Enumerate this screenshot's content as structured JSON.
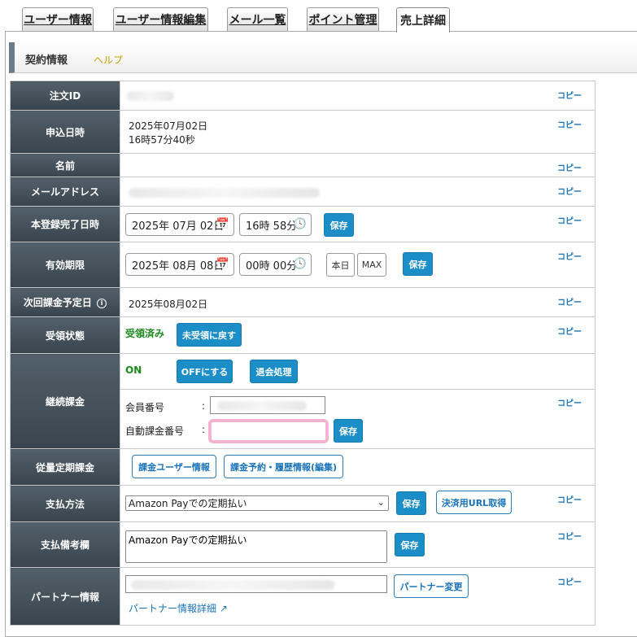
{
  "tabs": [
    {
      "label": "ユーザー情報"
    },
    {
      "label": "ユーザー情報編集"
    },
    {
      "label": "メール一覧"
    },
    {
      "label": "ポイント管理"
    },
    {
      "label": "売上詳細",
      "active": true
    }
  ],
  "section": {
    "title": "契約情報",
    "help": "ヘルプ"
  },
  "copy_label": "コピー",
  "rows": {
    "order_id": {
      "label": "注文ID"
    },
    "applied_at": {
      "label": "申込日時",
      "date": "2025年07月02日",
      "time": "16時57分40秒"
    },
    "name": {
      "label": "名前"
    },
    "email": {
      "label": "メールアドレス"
    },
    "registered_at": {
      "label": "本登録完了日時",
      "date": "2025年 07月 02日",
      "time": "16時 58分",
      "save": "保存"
    },
    "expiry": {
      "label": "有効期限",
      "date": "2025年 08月 08日",
      "time": "00時 00分",
      "today": "本日",
      "max": "MAX",
      "save": "保存"
    },
    "next_billing": {
      "label": "次回課金予定日",
      "info_icon": "info-circle-icon",
      "value": "2025年08月02日"
    },
    "receipt": {
      "label": "受領状態",
      "status": "受領済み",
      "button": "未受領に戻す"
    },
    "recurring": {
      "label": "継続課金",
      "status": "ON",
      "off_button": "OFFにする",
      "withdraw_button": "退会処理",
      "member_no_label": "会員番号",
      "auto_billing_label": "自動課金番号",
      "colon": ":",
      "save": "保存"
    },
    "metered": {
      "label": "従量定期課金",
      "user_info_button": "課金ユーザー情報",
      "reservation_button": "課金予約・履歴情報(編集)"
    },
    "payment_method": {
      "label": "支払方法",
      "selected": "Amazon Payでの定期払い",
      "save": "保存",
      "url_button": "決済用URL取得"
    },
    "payment_note": {
      "label": "支払備考欄",
      "value": "Amazon Payでの定期払い",
      "save": "保存"
    },
    "partner": {
      "label": "パートナー情報",
      "change_button": "パートナー変更",
      "detail_link": "パートナー情報詳細"
    }
  },
  "colors": {
    "primary_button": "#1b8ec8",
    "label_bg": "#3e4a53",
    "link": "#1a73b8",
    "ok_green": "#1d8a1d",
    "highlight": "#f4b4cf"
  }
}
